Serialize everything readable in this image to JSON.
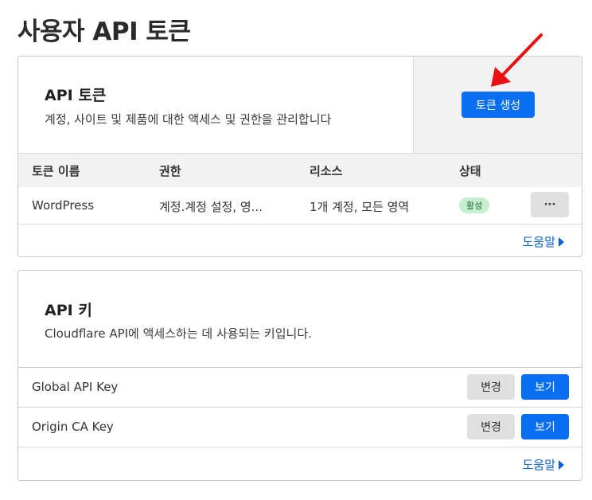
{
  "page": {
    "title": "사용자 API 토큰"
  },
  "api_tokens": {
    "title": "API 토큰",
    "description": "계정, 사이트 및 제품에 대한 액세스 및 권한을 관리합니다",
    "create_button": "토큰 생성",
    "columns": [
      "토큰 이름",
      "권한",
      "리소스",
      "상태"
    ],
    "rows": [
      {
        "name": "WordPress",
        "permissions": "계정.계정 설정, 영...",
        "resources": "1개 계정, 모든 영역",
        "status": "활성",
        "menu": "···"
      }
    ],
    "help": "도움말"
  },
  "api_keys": {
    "title": "API 키",
    "description": "Cloudflare API에 액세스하는 데 사용되는 키입니다.",
    "rows": [
      {
        "name": "Global API Key",
        "change": "변경",
        "view": "보기"
      },
      {
        "name": "Origin CA Key",
        "change": "변경",
        "view": "보기"
      }
    ],
    "help": "도움말"
  },
  "colors": {
    "primary": "#0a6ef0",
    "badge_bg": "#c6efcf",
    "annotation_arrow": "#e81010",
    "link": "#0a5fd6"
  },
  "icons": {
    "menu": "more-horizontal-icon",
    "help_arrow": "triangle-right-icon",
    "annotation": "red-arrow-icon"
  }
}
